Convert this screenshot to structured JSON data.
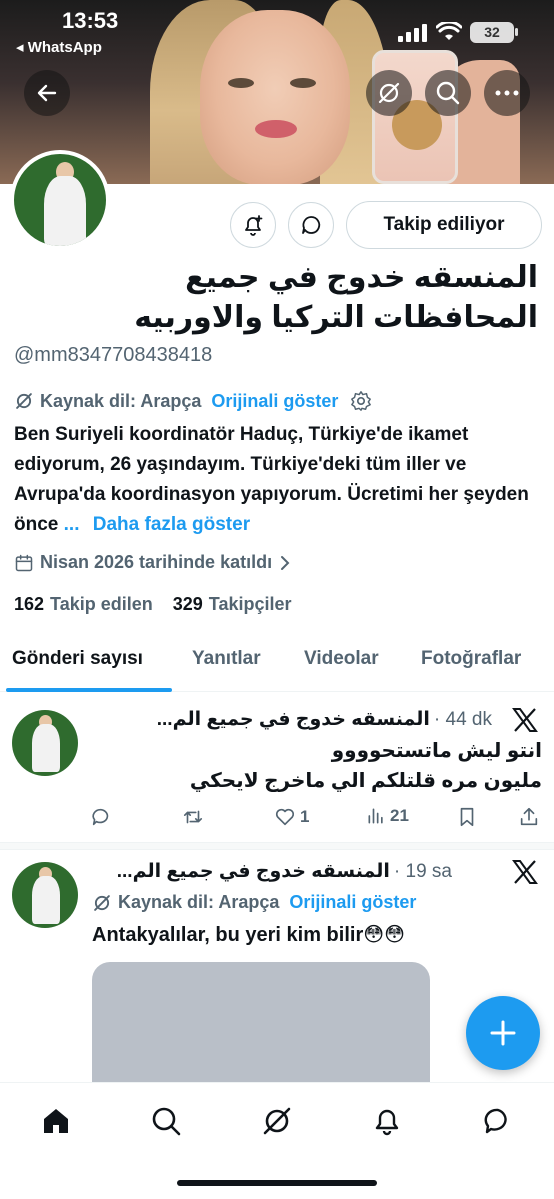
{
  "status_bar": {
    "time": "13:53",
    "back_app_label": "◂ WhatsApp",
    "battery": "32"
  },
  "profile": {
    "display_name": "المنسقه خدوج في جميع المحافظات التركيا والاوربيه",
    "handle": "@mm8347708438418",
    "follow_button": "Takip ediliyor",
    "translation": {
      "source_label": "Kaynak dil: Arapça",
      "show_original": "Orijinali göster"
    },
    "bio": "Ben Suriyeli koordinatör Haduç, Türkiye'de ikamet ediyorum, 26 yaşındayım. Türkiye'deki tüm iller ve Avrupa'da koordinasyon yapıyorum. Ücretimi her şeyden önce",
    "bio_ellipsis": "...",
    "show_more": "Daha fazla göster",
    "joined": "Nisan 2026 tarihinde katıldı",
    "following_count": "162",
    "following_label": "Takip edilen",
    "followers_count": "329",
    "followers_label": "Takipçiler"
  },
  "tabs": [
    {
      "label": "Gönderi sayısı",
      "active": true
    },
    {
      "label": "Yanıtlar",
      "active": false
    },
    {
      "label": "Videolar",
      "active": false
    },
    {
      "label": "Fotoğraflar",
      "active": false
    }
  ],
  "tweets": [
    {
      "author": "المنسقه خدوج في جميع الم...",
      "time": "· 44 dk",
      "text_line1": "انتو ليش ماتستحوووو",
      "text_line2": "مليون مره قلتلكم الي ماخرج لايحكي",
      "replies": "",
      "retweets": "",
      "likes": "1",
      "views": "21"
    },
    {
      "author": "المنسقه خدوج في جميع الم...",
      "time": "· 19 sa",
      "translation_label": "Kaynak dil: Arapça",
      "show_original": "Orijinali göster",
      "text": "Antakyalılar, bu yeri kim bilir😳😳"
    }
  ],
  "icons": {
    "back": "arrow-left-icon",
    "grok": "grok-icon",
    "search": "search-icon",
    "more": "more-icon",
    "notify": "bell-plus-icon",
    "message": "message-icon",
    "x_logo": "x-logo-icon",
    "compose": "plus-icon"
  },
  "colors": {
    "accent": "#1d9bf0",
    "text": "#0f1419",
    "secondary": "#536471"
  }
}
